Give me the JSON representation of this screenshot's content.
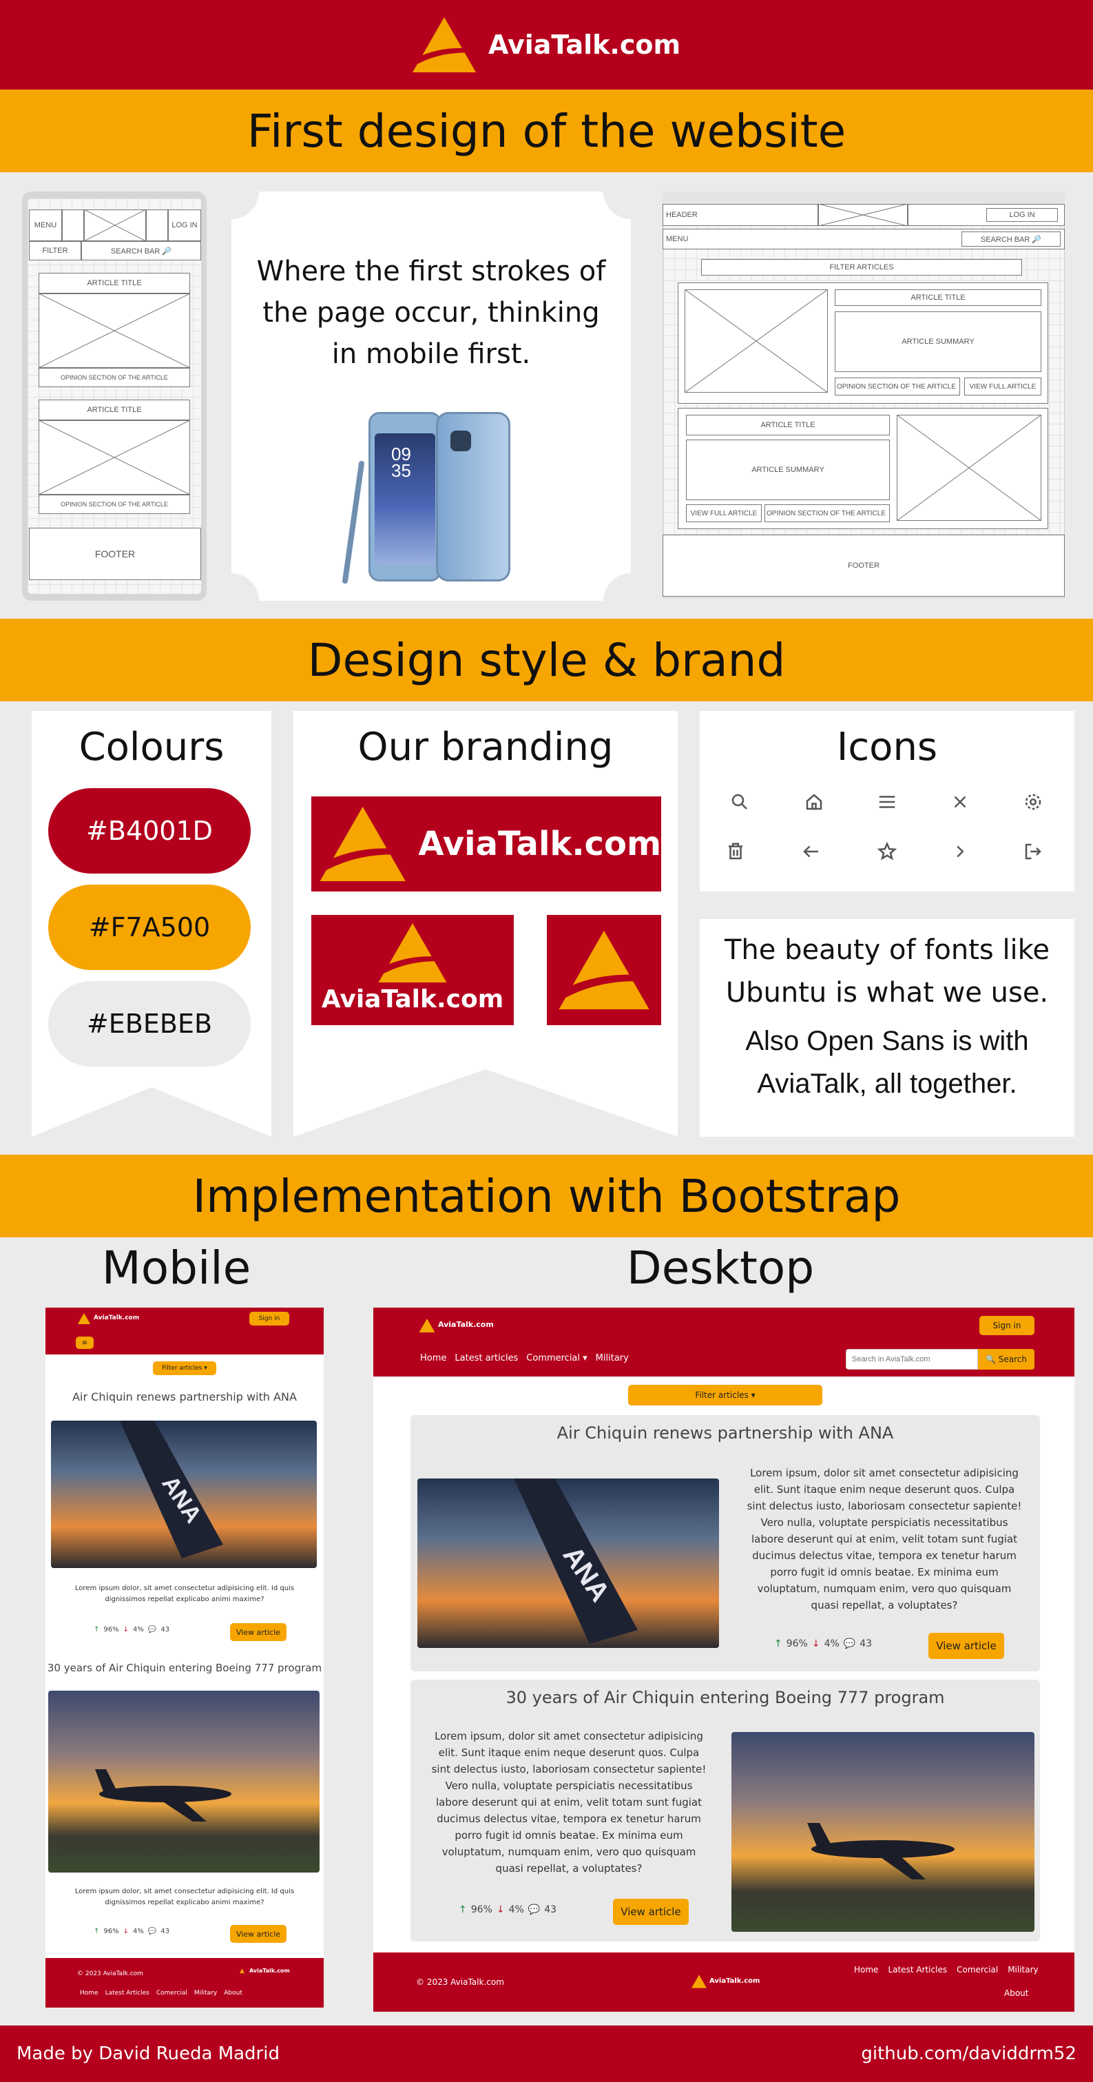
{
  "header": {
    "brand": "AviaTalk.com"
  },
  "bands": {
    "first_design": "First design of the website",
    "design_style": "Design style & brand",
    "implementation": "Implementation with Bootstrap"
  },
  "mobile_wireframe": {
    "menu": "MENU",
    "login": "LOG IN",
    "filter": "FILTER",
    "search": "SEARCH BAR 🔎",
    "article_title": "ARTICLE TITLE",
    "opinion": "OPINION SECTION OF THE ARTICLE",
    "footer": "FOOTER"
  },
  "first_design_text": "Where the first strokes of the page occur, thinking in mobile first.",
  "desktop_wireframe": {
    "header": "HEADER",
    "login": "LOG IN",
    "menu": "MENU",
    "search": "SEARCH BAR 🔎",
    "filter": "FILTER ARTICLES",
    "article_title": "ARTICLE TITLE",
    "article_summary": "ARTICLE SUMMARY",
    "opinion": "OPINION SECTION OF THE ARTICLE",
    "view_full": "VIEW FULL ARTICLE",
    "footer": "FOOTER"
  },
  "colours": {
    "title": "Colours",
    "swatches": [
      {
        "label": "#B4001D",
        "hex": "#B4001D",
        "text": "#ffffff"
      },
      {
        "label": "#F7A500",
        "hex": "#F7A500",
        "text": "#111111"
      },
      {
        "label": "#EBEBEB",
        "hex": "#EBEBEB",
        "text": "#111111"
      }
    ]
  },
  "branding": {
    "title": "Our branding",
    "brand": "AviaTalk.com"
  },
  "icons": {
    "title": "Icons",
    "names": [
      "search-icon",
      "home-icon",
      "menu-icon",
      "close-icon",
      "gear-icon",
      "trash-icon",
      "arrow-left-icon",
      "star-icon",
      "chevron-right-icon",
      "logout-icon"
    ]
  },
  "fonts": {
    "line1": "The beauty of fonts like Ubuntu is what we use.",
    "line2": "Also Open Sans is with AviaTalk, all together."
  },
  "implementation": {
    "mobile_label": "Mobile",
    "desktop_label": "Desktop",
    "brand": "AviaTalk.com",
    "sign_in": "Sign in",
    "filter": "Filter articles ▾",
    "nav": [
      "Home",
      "Latest articles",
      "Commercial ▾",
      "Military"
    ],
    "search_placeholder": "Search in AviaTalk.com",
    "search_button": "🔍 Search",
    "articles": [
      {
        "title": "Air Chiquin renews partnership with ANA",
        "short": "Lorem ipsum dolor, sit amet consectetur adipisicing elit. Id quis dignissimos repellat explicabo animi maxime?",
        "long": "Lorem ipsum, dolor sit amet consectetur adipisicing elit. Sunt itaque enim neque deserunt quos. Culpa sint delectus iusto, laboriosam consectetur sapiente! Vero nulla, voluptate perspiciatis necessitatibus labore deserunt qui at enim, velit totam sunt fugiat ducimus delectus vitae, tempora ex tenetur harum porro fugit id omnis beatae. Ex minima eum voluptatum, numquam enim, vero quo quisquam quasi repellat, a voluptates?",
        "up": "96%",
        "down": "4%",
        "comments": "43",
        "button": "View article"
      },
      {
        "title": "30 years of Air Chiquin entering Boeing 777 program",
        "short": "Lorem ipsum dolor, sit amet consectetur adipisicing elit. Id quis dignissimos repellat explicabo animi maxime?",
        "long": "Lorem ipsum, dolor sit amet consectetur adipisicing elit. Sunt itaque enim neque deserunt quos. Culpa sint delectus iusto, laboriosam consectetur sapiente! Vero nulla, voluptate perspiciatis necessitatibus labore deserunt qui at enim, velit totam sunt fugiat ducimus delectus vitae, tempora ex tenetur harum porro fugit id omnis beatae. Ex minima eum voluptatum, numquam enim, vero quo quisquam quasi repellat, a voluptates?",
        "up": "96%",
        "down": "4%",
        "comments": "43",
        "button": "View article"
      }
    ],
    "footer_copy": "© 2023 AviaTalk.com",
    "footer_links": [
      "Home",
      "Latest Articles",
      "Comercial",
      "Military",
      "About"
    ]
  },
  "bottom": {
    "author": "Made by David Rueda Madrid",
    "repo": "github.com/daviddrm52"
  }
}
